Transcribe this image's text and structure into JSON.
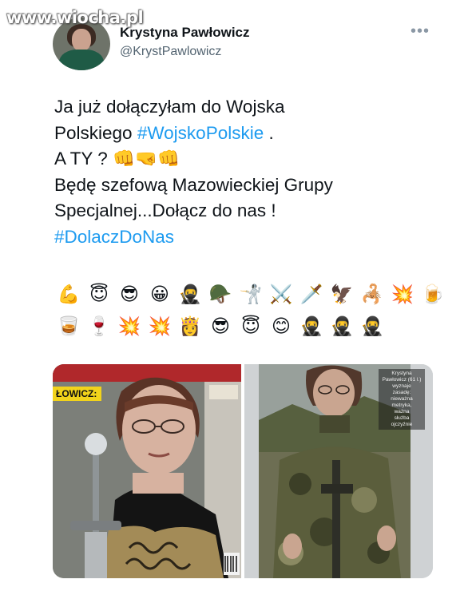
{
  "watermark": "www.wiocha.pl",
  "author": {
    "name": "Krystyna Pawłowicz",
    "handle": "@KrystPawlowicz"
  },
  "more_label": "•••",
  "tweet": {
    "lines": [
      "Ja już dołączyłam do Wojska",
      "Polskiego",
      "A TY ?",
      "Będę  szefową Mazowieckiej Grupy",
      "Specjalnej...Dołącz do nas !"
    ],
    "hashtag_1": "#WojskoPolskie",
    "after_hashtag_1": " .",
    "line3_emoji": "👊🤜👊",
    "hashtag_2": "#DolaczDoNas"
  },
  "emoji_rows": [
    [
      "💪",
      "😇",
      "😎",
      "😀",
      "🥷",
      "🪖",
      "🤺",
      "⚔️",
      "🗡️",
      "🦅",
      "🦂",
      "💥",
      "🍺"
    ],
    [
      "🥃",
      "🍷",
      "💥",
      "💥",
      "👸",
      "😎",
      "😇",
      "😊",
      "🥷",
      "🥷",
      "🥷"
    ]
  ],
  "media": {
    "left_photo_tag": "ŁOWICZ:",
    "right_photo_caption": [
      "Krystyna",
      "Pawłowicz (61 l.)",
      "wyznaje",
      "zasadę:",
      "nieważna",
      "metryka,",
      "ważna",
      "służba",
      "ojczyźnie"
    ]
  }
}
